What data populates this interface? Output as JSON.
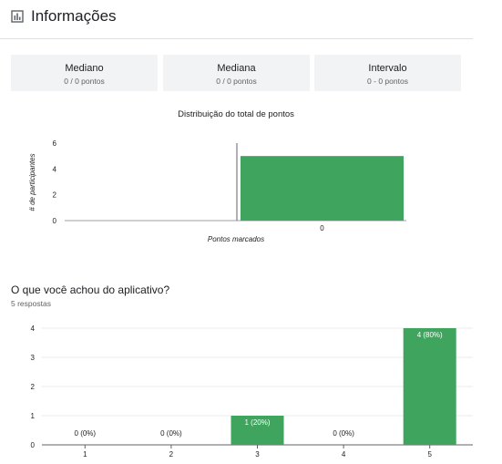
{
  "header": {
    "title": "Informações",
    "icon": "bar-chart-icon"
  },
  "stats": [
    {
      "label": "Mediano",
      "value": "0 / 0 pontos"
    },
    {
      "label": "Mediana",
      "value": "0 / 0 pontos"
    },
    {
      "label": "Intervalo",
      "value": "0 - 0 pontos"
    }
  ],
  "colors": {
    "bar": "#3fa45d",
    "axis": "#5f6368",
    "grid": "#ebebeb"
  },
  "question": {
    "title": "O que você achou do aplicativo?",
    "responses": "5 respostas"
  },
  "chart_data": [
    {
      "type": "bar",
      "title": "Distribuição do total de pontos",
      "xlabel": "Pontos marcados",
      "ylabel": "# de participantes",
      "categories": [
        "0"
      ],
      "values": [
        5
      ],
      "ylim": [
        0,
        6
      ],
      "yticks": [
        0,
        2,
        4,
        6
      ],
      "grid": false
    },
    {
      "type": "bar",
      "title": "",
      "xlabel": "",
      "ylabel": "",
      "categories": [
        "1",
        "2",
        "3",
        "4",
        "5"
      ],
      "values": [
        0,
        0,
        1,
        0,
        4
      ],
      "data_labels": [
        "0 (0%)",
        "0 (0%)",
        "1 (20%)",
        "0 (0%)",
        "4 (80%)"
      ],
      "ylim": [
        0,
        4
      ],
      "yticks": [
        0,
        1,
        2,
        3,
        4
      ],
      "grid": true
    }
  ]
}
